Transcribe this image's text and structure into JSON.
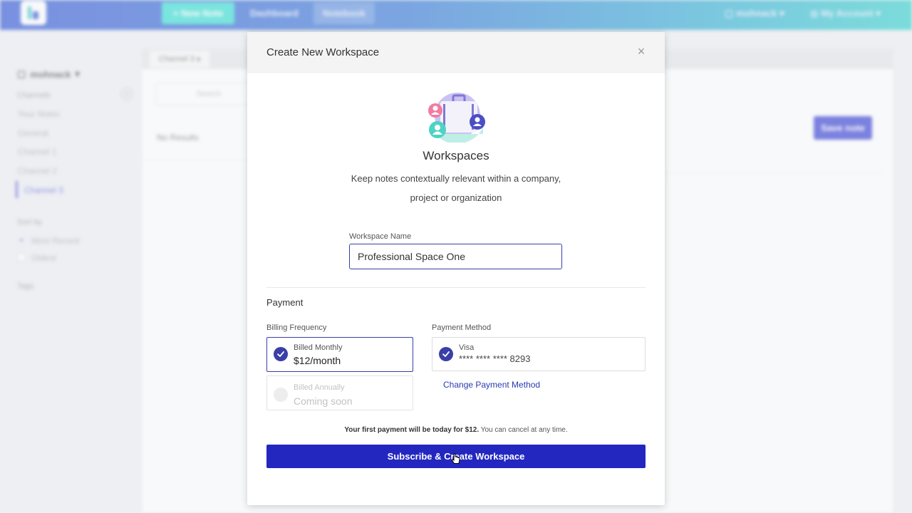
{
  "topbar": {
    "new_note_label": "+ New Note",
    "nav": [
      {
        "label": "Dashboard"
      },
      {
        "label": "Notebook"
      }
    ],
    "user_label": "mohnack",
    "account_label": "My Account"
  },
  "sidebar": {
    "workspace_label": "mohnack",
    "channels_heading": "Channels",
    "items": [
      {
        "label": "Your Notes"
      },
      {
        "label": "General"
      },
      {
        "label": "Channel 1"
      },
      {
        "label": "Channel 2"
      },
      {
        "label": "Channel 3"
      }
    ],
    "sort_heading": "Sort by",
    "sort_options": [
      {
        "label": "Most Recent"
      },
      {
        "label": "Oldest"
      }
    ],
    "tags_heading": "Tags"
  },
  "main": {
    "tab_label": "Channel 3",
    "search_placeholder": "Search",
    "no_results": "No Results",
    "save_label": "Save note"
  },
  "modal": {
    "title": "Create New Workspace",
    "close_symbol": "×",
    "heading": "Workspaces",
    "description": "Keep notes contextually relevant within a company, project or organization",
    "workspace_name_label": "Workspace Name",
    "workspace_name_value": "Professional Space One",
    "payment_heading": "Payment",
    "billing_frequency_label": "Billing Frequency",
    "billing_options": [
      {
        "sub": "Billed Monthly",
        "main": "$12/month"
      },
      {
        "sub": "Billed Annually",
        "main": "Coming soon"
      }
    ],
    "payment_method_label": "Payment Method",
    "payment_method": {
      "sub": "Visa",
      "main": "**** **** **** 8293"
    },
    "change_payment_label": "Change Payment Method",
    "notice_strong": "Your first payment will be today for $12.",
    "notice_rest": " You can cancel at any time.",
    "submit_label": "Subscribe & Create Workspace"
  },
  "colors": {
    "accent": "#3a3fa8",
    "primary_button": "#2327c0",
    "link": "#2a3bb0"
  },
  "icons": [
    "logo-icon",
    "workspace-illustration-icon",
    "close-icon",
    "check-icon",
    "pointer-cursor-icon"
  ]
}
